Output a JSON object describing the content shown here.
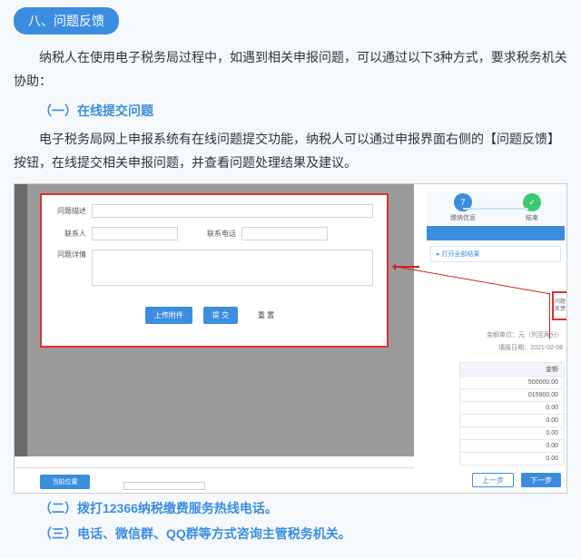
{
  "section_header": "八、问题反馈",
  "intro": "纳税人在使用电子税务局过程中，如遇到相关申报问题，可以通过以下3种方式，要求税务机关协助：",
  "sub1": "（一）在线提交问题",
  "desc1": "电子税务局网上申报系统有在线问题提交功能，纳税人可以通过申报界面右侧的【问题反馈】按钮，在线提交相关申报问题，并查看问题处理结果及建议。",
  "sub2": "（二）拨打12366纳税缴费服务热线电话。",
  "sub3": "（三）电话、微信群、QQ群等方式咨询主管税务机关。",
  "form": {
    "f1": "问题描述",
    "f2": "联系人",
    "f3": "联系电话",
    "f4": "问题详情",
    "btn_upload": "上传附件",
    "btn_submit": "提  交",
    "btn_reset": "重  置"
  },
  "right": {
    "step1_num": "7",
    "step1_label": "缴纳信息",
    "step2_label": "结束",
    "expand": "▸ 打开全部结果",
    "feedback_tab": "问题反馈",
    "unit": "金额单位：元（列至两分）",
    "deadline": "填报日期：2021-02-08",
    "col_header": "金额",
    "rows": [
      "500000.00",
      "015900.00",
      "0.00",
      "0.00",
      "0.00",
      "0.00",
      "0.00"
    ],
    "prev": "上一步",
    "next": "下一步"
  },
  "bottom_tab": "当前位置",
  "frag": " "
}
